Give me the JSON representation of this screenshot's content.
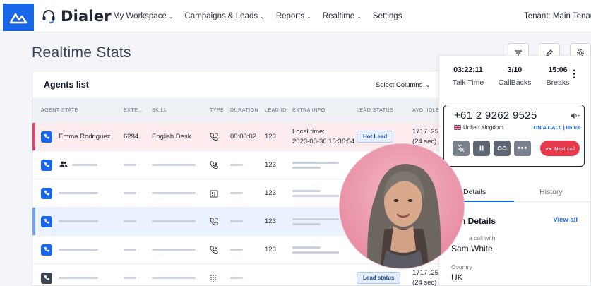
{
  "brand": {
    "name": "Dialer"
  },
  "nav": {
    "items": [
      {
        "label": "My Workspace",
        "has_menu": true
      },
      {
        "label": "Campaigns & Leads",
        "has_menu": true
      },
      {
        "label": "Reports",
        "has_menu": true
      },
      {
        "label": "Realtime",
        "has_menu": true
      },
      {
        "label": "Settings",
        "has_menu": false
      }
    ],
    "tenant": "Tenant: Main Tenan"
  },
  "page": {
    "title": "Realtime Stats"
  },
  "agents": {
    "title": "Agents list",
    "select_columns": "Select Columns",
    "columns": [
      "AGENT STATE",
      "EXTE...",
      "SKILL",
      "TYPE",
      "DURATION",
      "LEAD ID",
      "EXTRA INFO",
      "LEAD STATUS",
      "AVG. IDLE"
    ],
    "row1": {
      "name": "Emma Rodriguez",
      "extension": "6294",
      "skill": "English Desk",
      "duration": "00:00:02",
      "lead_id": "123",
      "extra_line1": "Local time:",
      "extra_line2": "2023-08-30 15:36:54",
      "lead_status": "Hot Lead",
      "avg_idle_1": "1717 .25",
      "avg_idle_2": "(24 sec)"
    },
    "row2": {
      "lead_id": "123"
    },
    "row3": {
      "lead_id": "123"
    },
    "row4": {
      "lead_id": "123"
    },
    "row5": {
      "lead_id": "123"
    },
    "row6": {
      "lead_status": "Lead status",
      "avg_idle_1": "1717 .25",
      "avg_idle_2": "(24 sec)"
    }
  },
  "call_card": {
    "talk_time_value": "03:22:11",
    "talk_time_label": "Talk Time",
    "callbacks_value": "3/10",
    "callbacks_label": "CallBacks",
    "breaks_value": "15:06",
    "breaks_label": "Breaks",
    "number": "+61 2 9262 9525",
    "country": "United Kingdom",
    "status": "ON A CALL | 00:03",
    "next_call": "Next call",
    "tab_details": "Details",
    "tab_history": "History",
    "details_title": "n Details",
    "view_all": "View all",
    "in_call_label": "a call with",
    "in_call_value": "Sam White",
    "country_label": "Country",
    "country_value": "UK"
  },
  "colors": {
    "accent": "#1a66e8",
    "danger": "#e63a4c",
    "active_row": "#fdecee",
    "selected_row": "#eaf2ff"
  }
}
